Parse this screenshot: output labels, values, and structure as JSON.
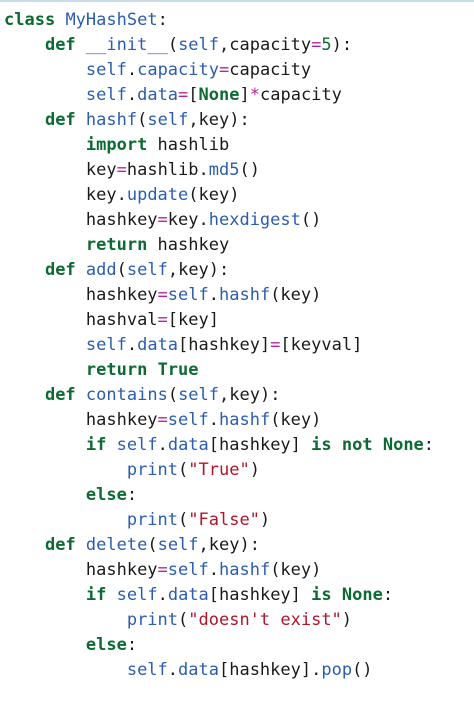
{
  "lines": [
    {
      "indent": 0,
      "tokens": [
        [
          "kw",
          "class"
        ],
        [
          "tx",
          " "
        ],
        [
          "bl",
          "MyHashSet"
        ],
        [
          "tx",
          ":"
        ]
      ]
    },
    {
      "indent": 1,
      "tokens": [
        [
          "kw",
          "def"
        ],
        [
          "tx",
          " "
        ],
        [
          "bl",
          "__init__"
        ],
        [
          "tx",
          "("
        ],
        [
          "bl",
          "self"
        ],
        [
          "tx",
          ",capacity"
        ],
        [
          "op",
          "="
        ],
        [
          "nm",
          "5"
        ],
        [
          "tx",
          "):"
        ]
      ]
    },
    {
      "indent": 2,
      "tokens": [
        [
          "bl",
          "self"
        ],
        [
          "tx",
          "."
        ],
        [
          "bl",
          "capacity"
        ],
        [
          "op",
          "="
        ],
        [
          "tx",
          "capacity"
        ]
      ]
    },
    {
      "indent": 2,
      "tokens": [
        [
          "bl",
          "self"
        ],
        [
          "tx",
          "."
        ],
        [
          "bl",
          "data"
        ],
        [
          "op",
          "="
        ],
        [
          "tx",
          "["
        ],
        [
          "kw",
          "None"
        ],
        [
          "tx",
          "]"
        ],
        [
          "op",
          "*"
        ],
        [
          "tx",
          "capacity"
        ]
      ]
    },
    {
      "indent": 1,
      "tokens": [
        [
          "kw",
          "def"
        ],
        [
          "tx",
          " "
        ],
        [
          "bl",
          "hashf"
        ],
        [
          "tx",
          "("
        ],
        [
          "bl",
          "self"
        ],
        [
          "tx",
          ",key):"
        ]
      ]
    },
    {
      "indent": 2,
      "tokens": [
        [
          "kw",
          "import"
        ],
        [
          "tx",
          " hashlib"
        ]
      ]
    },
    {
      "indent": 2,
      "tokens": [
        [
          "tx",
          "key"
        ],
        [
          "op",
          "="
        ],
        [
          "tx",
          "hashlib."
        ],
        [
          "bl",
          "md5"
        ],
        [
          "tx",
          "()"
        ]
      ]
    },
    {
      "indent": 2,
      "tokens": [
        [
          "tx",
          "key."
        ],
        [
          "bl",
          "update"
        ],
        [
          "tx",
          "(key)"
        ]
      ]
    },
    {
      "indent": 2,
      "tokens": [
        [
          "tx",
          "hashkey"
        ],
        [
          "op",
          "="
        ],
        [
          "tx",
          "key."
        ],
        [
          "bl",
          "hexdigest"
        ],
        [
          "tx",
          "()"
        ]
      ]
    },
    {
      "indent": 2,
      "tokens": [
        [
          "kw",
          "return"
        ],
        [
          "tx",
          " hashkey"
        ]
      ]
    },
    {
      "indent": 1,
      "tokens": [
        [
          "kw",
          "def"
        ],
        [
          "tx",
          " "
        ],
        [
          "bl",
          "add"
        ],
        [
          "tx",
          "("
        ],
        [
          "bl",
          "self"
        ],
        [
          "tx",
          ",key):"
        ]
      ]
    },
    {
      "indent": 2,
      "tokens": [
        [
          "tx",
          "hashkey"
        ],
        [
          "op",
          "="
        ],
        [
          "bl",
          "self"
        ],
        [
          "tx",
          "."
        ],
        [
          "bl",
          "hashf"
        ],
        [
          "tx",
          "(key)"
        ]
      ]
    },
    {
      "indent": 2,
      "tokens": [
        [
          "tx",
          "hashval"
        ],
        [
          "op",
          "="
        ],
        [
          "tx",
          "[key]"
        ]
      ]
    },
    {
      "indent": 2,
      "tokens": [
        [
          "bl",
          "self"
        ],
        [
          "tx",
          "."
        ],
        [
          "bl",
          "data"
        ],
        [
          "tx",
          "[hashkey]"
        ],
        [
          "op",
          "="
        ],
        [
          "tx",
          "[keyval]"
        ]
      ]
    },
    {
      "indent": 2,
      "tokens": [
        [
          "kw",
          "return"
        ],
        [
          "tx",
          " "
        ],
        [
          "kw",
          "True"
        ]
      ]
    },
    {
      "indent": 1,
      "tokens": [
        [
          "kw",
          "def"
        ],
        [
          "tx",
          " "
        ],
        [
          "bl",
          "contains"
        ],
        [
          "tx",
          "("
        ],
        [
          "bl",
          "self"
        ],
        [
          "tx",
          ",key):"
        ]
      ]
    },
    {
      "indent": 2,
      "tokens": [
        [
          "tx",
          "hashkey"
        ],
        [
          "op",
          "="
        ],
        [
          "bl",
          "self"
        ],
        [
          "tx",
          "."
        ],
        [
          "bl",
          "hashf"
        ],
        [
          "tx",
          "(key)"
        ]
      ]
    },
    {
      "indent": 2,
      "tokens": [
        [
          "kw",
          "if"
        ],
        [
          "tx",
          " "
        ],
        [
          "bl",
          "self"
        ],
        [
          "tx",
          "."
        ],
        [
          "bl",
          "data"
        ],
        [
          "tx",
          "[hashkey] "
        ],
        [
          "kw",
          "is"
        ],
        [
          "tx",
          " "
        ],
        [
          "kw",
          "not"
        ],
        [
          "tx",
          " "
        ],
        [
          "kw",
          "None"
        ],
        [
          "tx",
          ":"
        ]
      ]
    },
    {
      "indent": 3,
      "tokens": [
        [
          "bl",
          "print"
        ],
        [
          "tx",
          "("
        ],
        [
          "st",
          "\"True\""
        ],
        [
          "tx",
          ")"
        ]
      ]
    },
    {
      "indent": 2,
      "tokens": [
        [
          "kw",
          "else"
        ],
        [
          "tx",
          ":"
        ]
      ]
    },
    {
      "indent": 3,
      "tokens": [
        [
          "bl",
          "print"
        ],
        [
          "tx",
          "("
        ],
        [
          "st",
          "\"False\""
        ],
        [
          "tx",
          ")"
        ]
      ]
    },
    {
      "indent": 1,
      "tokens": [
        [
          "kw",
          "def"
        ],
        [
          "tx",
          " "
        ],
        [
          "bl",
          "delete"
        ],
        [
          "tx",
          "("
        ],
        [
          "bl",
          "self"
        ],
        [
          "tx",
          ",key):"
        ]
      ]
    },
    {
      "indent": 2,
      "tokens": [
        [
          "tx",
          "hashkey"
        ],
        [
          "op",
          "="
        ],
        [
          "bl",
          "self"
        ],
        [
          "tx",
          "."
        ],
        [
          "bl",
          "hashf"
        ],
        [
          "tx",
          "(key)"
        ]
      ]
    },
    {
      "indent": 2,
      "tokens": [
        [
          "kw",
          "if"
        ],
        [
          "tx",
          " "
        ],
        [
          "bl",
          "self"
        ],
        [
          "tx",
          "."
        ],
        [
          "bl",
          "data"
        ],
        [
          "tx",
          "[hashkey] "
        ],
        [
          "kw",
          "is"
        ],
        [
          "tx",
          " "
        ],
        [
          "kw",
          "None"
        ],
        [
          "tx",
          ":"
        ]
      ]
    },
    {
      "indent": 3,
      "tokens": [
        [
          "bl",
          "print"
        ],
        [
          "tx",
          "("
        ],
        [
          "st",
          "\"doesn't exist\""
        ],
        [
          "tx",
          ")"
        ]
      ]
    },
    {
      "indent": 2,
      "tokens": [
        [
          "kw",
          "else"
        ],
        [
          "tx",
          ":"
        ]
      ]
    },
    {
      "indent": 3,
      "tokens": [
        [
          "bl",
          "self"
        ],
        [
          "tx",
          "."
        ],
        [
          "bl",
          "data"
        ],
        [
          "tx",
          "[hashkey]."
        ],
        [
          "bl",
          "pop"
        ],
        [
          "tx",
          "()"
        ]
      ]
    }
  ]
}
